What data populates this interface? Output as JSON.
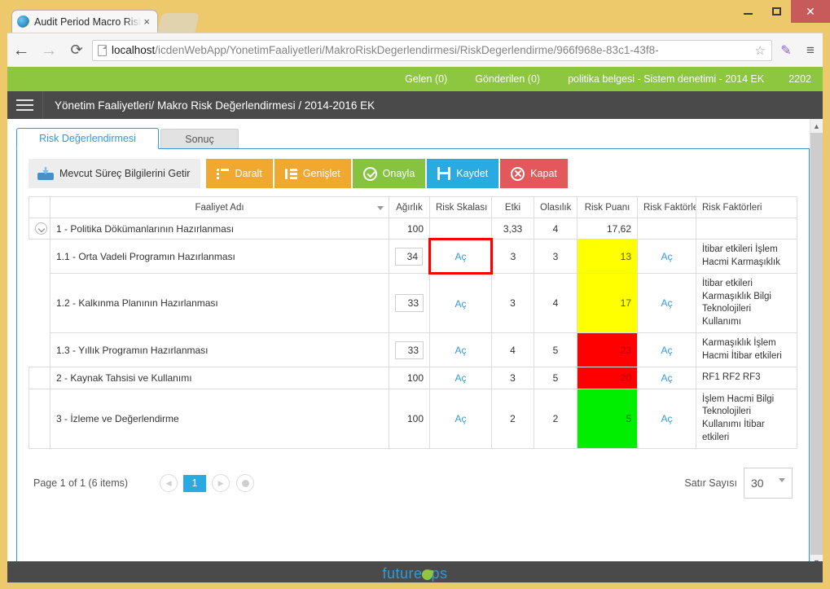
{
  "browser": {
    "tab_title": "Audit Period Macro Risk A",
    "tab_close": "×",
    "url_host": "localhost",
    "url_rest": "/icdenWebApp/YonetimFaaliyetleri/MakroRiskDegerlendirmesi/RiskDegerlendirme/966f968e-83c1-43f8-",
    "back": "←",
    "forward": "→",
    "reload": "⟳",
    "star": "☆",
    "extension": "✎",
    "menu": "≡",
    "minimize": "",
    "maximize": "",
    "close": "✕"
  },
  "topbar": {
    "inbox": "Gelen (0)",
    "sent": "Gönderilen (0)",
    "context": "politika belgesi - Sistem denetimi - 2014 EK",
    "user_id": "2202"
  },
  "breadcrumb": "Yönetim Faaliyetleri/ Makro Risk Değerlendirmesi / 2014-2016 EK",
  "tabs": [
    {
      "label": "Risk Değerlendirmesi",
      "active": true
    },
    {
      "label": "Sonuç",
      "active": false
    }
  ],
  "toolbar": {
    "fetch_label": "Mevcut Süreç Bilgilerini Getir",
    "collapse_label": "Daralt",
    "expand_label": "Genişlet",
    "approve_label": "Onayla",
    "save_label": "Kaydet",
    "close_label": "Kapat"
  },
  "grid": {
    "columns": [
      "Faaliyet Adı",
      "Ağırlık",
      "Risk Skalası",
      "Etki",
      "Olasılık",
      "Risk Puanı",
      "Risk Faktörleri",
      "Risk Faktörleri"
    ],
    "open_link": "Aç",
    "rows": [
      {
        "kind": "group",
        "name": "1 - Politika Dökümanlarının Hazırlanması",
        "weight": "100",
        "scale": "",
        "impact": "3,33",
        "likelihood": "4",
        "score": "17,62",
        "score_color": "none",
        "factors": "",
        "has_scale_link": false,
        "has_factor_link": false
      },
      {
        "kind": "child",
        "name": "1.1 - Orta Vadeli Programın Hazırlanması",
        "weight": "34",
        "scale": "Aç",
        "impact": "3",
        "likelihood": "3",
        "score": "13",
        "score_color": "yellow",
        "factors": "İtibar etkileri İşlem Hacmi Karmaşıklık",
        "has_scale_link": true,
        "has_factor_link": true,
        "scale_error": true
      },
      {
        "kind": "child",
        "name": "1.2 - Kalkınma Planının Hazırlanması",
        "weight": "33",
        "scale": "Aç",
        "impact": "3",
        "likelihood": "4",
        "score": "17",
        "score_color": "yellow",
        "factors": "İtibar etkileri Karmaşıklık Bilgi Teknolojileri Kullanımı",
        "has_scale_link": true,
        "has_factor_link": true,
        "scale_error": false
      },
      {
        "kind": "child",
        "name": "1.3 - Yıllık Programın Hazırlanması",
        "weight": "33",
        "scale": "Aç",
        "impact": "4",
        "likelihood": "5",
        "score": "23",
        "score_color": "red",
        "factors": "Karmaşıklık İşlem Hacmi İtibar etkileri",
        "has_scale_link": true,
        "has_factor_link": true,
        "scale_error": false
      },
      {
        "kind": "top",
        "name": "2 - Kaynak Tahsisi ve Kullanımı",
        "weight": "100",
        "scale": "Aç",
        "impact": "3",
        "likelihood": "5",
        "score": "20",
        "score_color": "red",
        "factors": "RF1 RF2 RF3",
        "has_scale_link": true,
        "has_factor_link": true,
        "scale_error": false
      },
      {
        "kind": "top",
        "name": "3 - İzleme ve Değerlendirme",
        "weight": "100",
        "scale": "Aç",
        "impact": "2",
        "likelihood": "2",
        "score": "5",
        "score_color": "green",
        "factors": "İşlem Hacmi Bilgi Teknolojileri Kullanımı İtibar etkileri",
        "has_scale_link": true,
        "has_factor_link": true,
        "scale_error": false
      }
    ]
  },
  "pager": {
    "text": "Page 1 of 1 (6 items)",
    "prev": "◀",
    "next": "▶",
    "current_page": "1",
    "rows_label": "Satır Sayısı",
    "rows_value": "30"
  },
  "footer": {
    "logo_before": "future",
    "logo_after": "ps"
  },
  "colors": {
    "accent_green": "#8dc63f",
    "accent_blue": "#29abe2",
    "orange": "#f0a830",
    "red": "#e2585b",
    "risk_yellow": "#ffff00",
    "risk_red": "#ff0000",
    "risk_green": "#00ee00",
    "link": "#3399dd"
  }
}
